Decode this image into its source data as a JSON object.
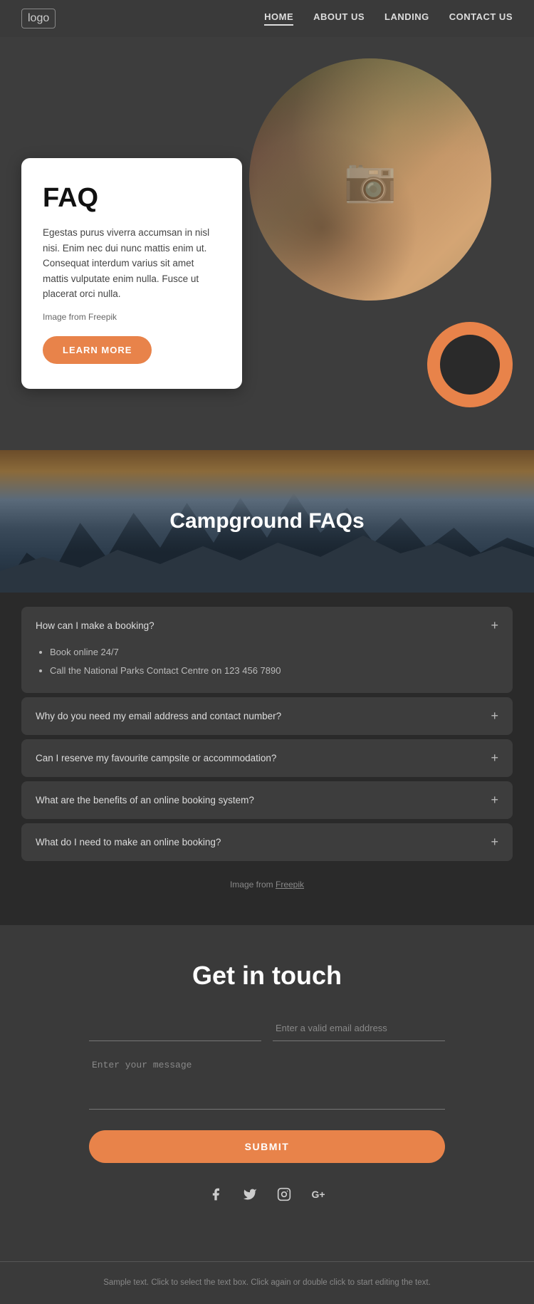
{
  "nav": {
    "logo": "logo",
    "links": [
      {
        "label": "HOME",
        "active": true
      },
      {
        "label": "ABOUT US",
        "active": false
      },
      {
        "label": "LANDING",
        "active": false
      },
      {
        "label": "CONTACT US",
        "active": false
      }
    ]
  },
  "hero": {
    "faq_title": "FAQ",
    "faq_text": "Egestas purus viverra accumsan in nisl nisi. Enim nec dui nunc mattis enim ut. Consequat interdum varius sit amet mattis vulputate enim nulla. Fusce ut placerat orci nulla.",
    "image_credit": "Image from Freepik",
    "learn_more_label": "LEARN MORE"
  },
  "campground": {
    "title": "Campground FAQs",
    "faqs": [
      {
        "question": "How can I make a booking?",
        "expanded": true,
        "answer_items": [
          "Book online 24/7",
          "Call the National Parks Contact Centre on 123 456 7890"
        ]
      },
      {
        "question": "Why do you need my email address and contact number?",
        "expanded": false,
        "answer_items": []
      },
      {
        "question": "Can I reserve my favourite campsite or accommodation?",
        "expanded": false,
        "answer_items": []
      },
      {
        "question": "What are the benefits of an online booking system?",
        "expanded": false,
        "answer_items": []
      },
      {
        "question": "What do I need to make an online booking?",
        "expanded": false,
        "answer_items": []
      }
    ],
    "image_credit_text": "Image from ",
    "image_credit_link": "Freepik"
  },
  "contact": {
    "title": "Get in touch",
    "name_placeholder": "",
    "email_placeholder": "Enter a valid email address",
    "message_placeholder": "Enter your message",
    "submit_label": "SUBMIT"
  },
  "social": {
    "icons": [
      {
        "name": "facebook",
        "symbol": "f"
      },
      {
        "name": "twitter",
        "symbol": "t"
      },
      {
        "name": "instagram",
        "symbol": "◎"
      },
      {
        "name": "googleplus",
        "symbol": "G+"
      }
    ]
  },
  "footer": {
    "text": "Sample text. Click to select the text box. Click again or double\nclick to start editing the text."
  }
}
